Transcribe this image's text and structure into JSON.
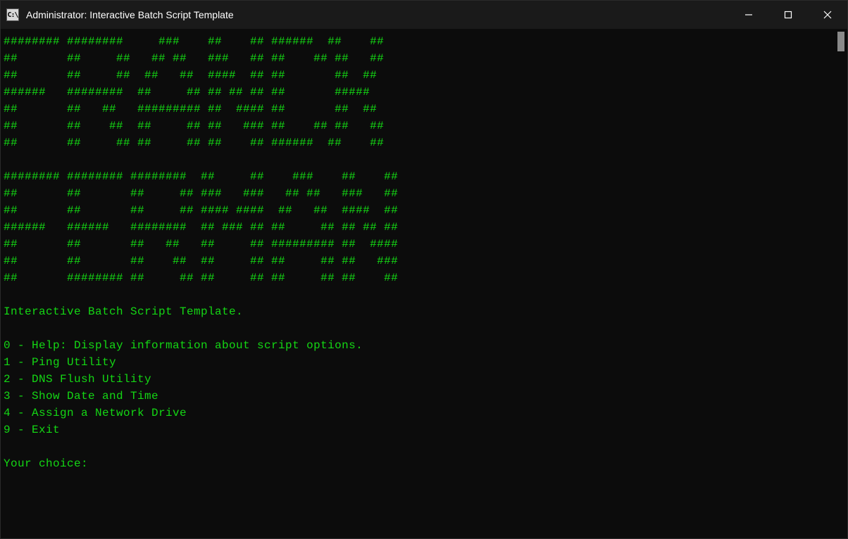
{
  "window": {
    "icon_label": "C:\\",
    "title": "Administrator:  Interactive Batch Script Template"
  },
  "ascii_art": "######## ########     ###    ##    ## ######  ##    ##\n##       ##     ##   ## ##   ###   ## ##    ## ##   ##\n##       ##     ##  ##   ##  ####  ## ##       ##  ##\n######   ########  ##     ## ## ## ## ##       #####\n##       ##   ##   ######### ##  #### ##       ##  ##\n##       ##    ##  ##     ## ##   ### ##    ## ##   ##\n##       ##     ## ##     ## ##    ## ######  ##    ##\n\n######## ######## ########  ##     ##    ###    ##    ##\n##       ##       ##     ## ###   ###   ## ##   ###   ##\n##       ##       ##     ## #### ####  ##   ##  ####  ##\n######   ######   ########  ## ### ## ##     ## ## ## ##\n##       ##       ##   ##   ##     ## ######### ##  ####\n##       ##       ##    ##  ##     ## ##     ## ##   ###\n##       ######## ##     ## ##     ## ##     ## ##    ##",
  "content": {
    "heading": "Interactive Batch Script Template.",
    "menu": [
      "0 - Help: Display information about script options.",
      "1 - Ping Utility",
      "2 - DNS Flush Utility",
      "3 - Show Date and Time",
      "4 - Assign a Network Drive",
      "9 - Exit"
    ],
    "prompt": "Your choice:"
  },
  "colors": {
    "terminal_fg": "#14d714",
    "terminal_bg": "#0c0c0c",
    "titlebar_bg": "#1a1a1a"
  }
}
